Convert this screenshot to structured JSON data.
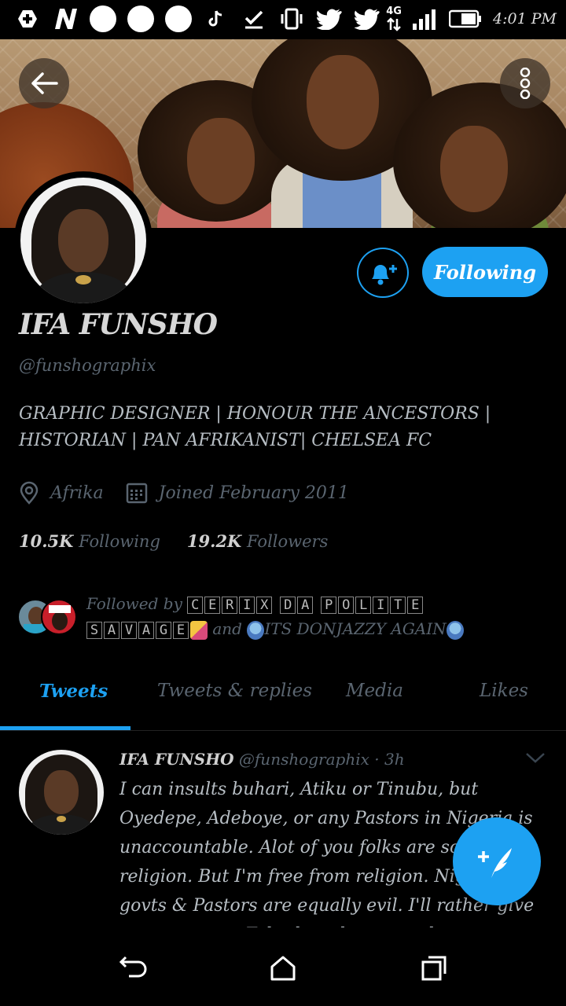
{
  "status_bar": {
    "time": "4:01 PM",
    "network": "4G",
    "icons": [
      "add-circle-icon",
      "n-app-icon",
      "notification-dot-icon",
      "notification-dot-icon",
      "notification-dot-icon",
      "tiktok-icon",
      "checkmark-icon",
      "vibrate-icon",
      "twitter-icon",
      "twitter-icon",
      "network-4g-icon",
      "signal-icon",
      "battery-icon"
    ]
  },
  "header": {
    "back_icon": "arrow-left-icon",
    "more_icon": "more-vertical-icon"
  },
  "profile": {
    "name": "IFA FUNSHO",
    "handle": "@funshographix",
    "bio": "GRAPHIC DESIGNER | HONOUR THE ANCESTORS | HISTORIAN  | PAN AFRIKANIST| CHELSEA FC",
    "location": "Afrika",
    "joined": "Joined February 2011",
    "following_count": "10.5K",
    "following_label": "Following",
    "followers_count": "19.2K",
    "followers_label": "Followers",
    "follow_button_label": "Following"
  },
  "followed_by": {
    "prefix": "Followed by",
    "name1_letters": [
      "C",
      "E",
      "R",
      "I",
      "X"
    ],
    "name1_letters_2": [
      "D",
      "A"
    ],
    "name1_letters_3": [
      "P",
      "O",
      "L",
      "I",
      "T",
      "E"
    ],
    "name1_letters_4": [
      "S",
      "A",
      "V",
      "A",
      "G",
      "E"
    ],
    "and_label": "and",
    "name2": "ITS DONJAZZY AGAIN"
  },
  "tabs": [
    {
      "label": "Tweets",
      "active": true
    },
    {
      "label": "Tweets & replies",
      "active": false
    },
    {
      "label": "Media",
      "active": false
    },
    {
      "label": "Likes",
      "active": false
    }
  ],
  "tweet": {
    "author": "IFA FUNSHO",
    "handle": "@funshographix",
    "time": "· 3h",
    "text": "I can insults buhari, Atiku or Tinubu, but Oyedepe, Adeboye, or any Pastors in Nigeria is unaccountable. Alot of you folks are scared of religion. But I'm free from religion. Nigerian govts & Pastors are equally evil. I'll rather give my respect to Fela than these people."
  },
  "colors": {
    "accent": "#1da1f2",
    "background": "#000000",
    "muted_text": "#5a6570"
  }
}
